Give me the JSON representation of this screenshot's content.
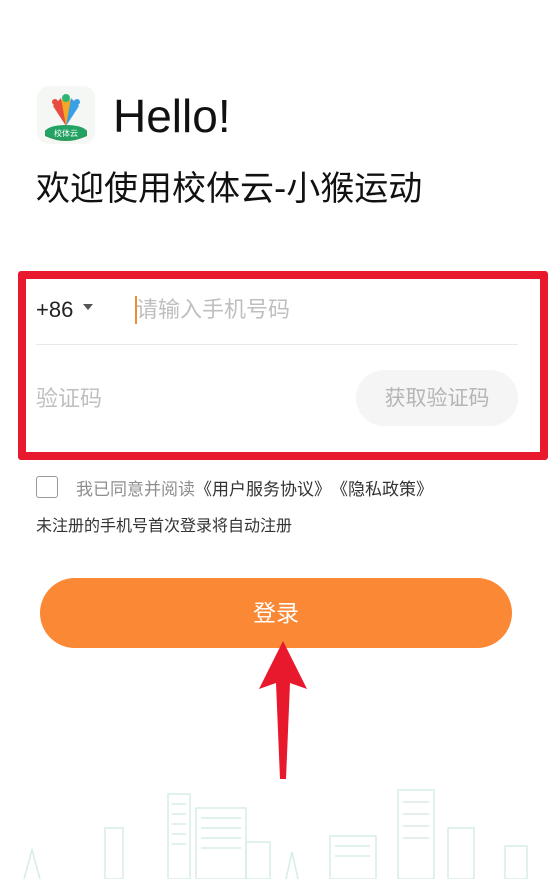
{
  "header": {
    "logo_icon": "xiaotiyun-logo-icon",
    "hello": "Hello!",
    "welcome": "欢迎使用校体云-小猴运动"
  },
  "form": {
    "country_code": "+86",
    "phone_placeholder": "请输入手机号码",
    "code_placeholder": "验证码",
    "get_code_label": "获取验证码"
  },
  "agreement": {
    "prefix": "我已同意并阅读",
    "user_agreement": "《用户服务协议》",
    "privacy_policy": "《隐私政策》",
    "notice": "未注册的手机号首次登录将自动注册"
  },
  "login": {
    "label": "登录"
  },
  "colors": {
    "accent": "#fb8834",
    "annotation": "#e8192c"
  }
}
